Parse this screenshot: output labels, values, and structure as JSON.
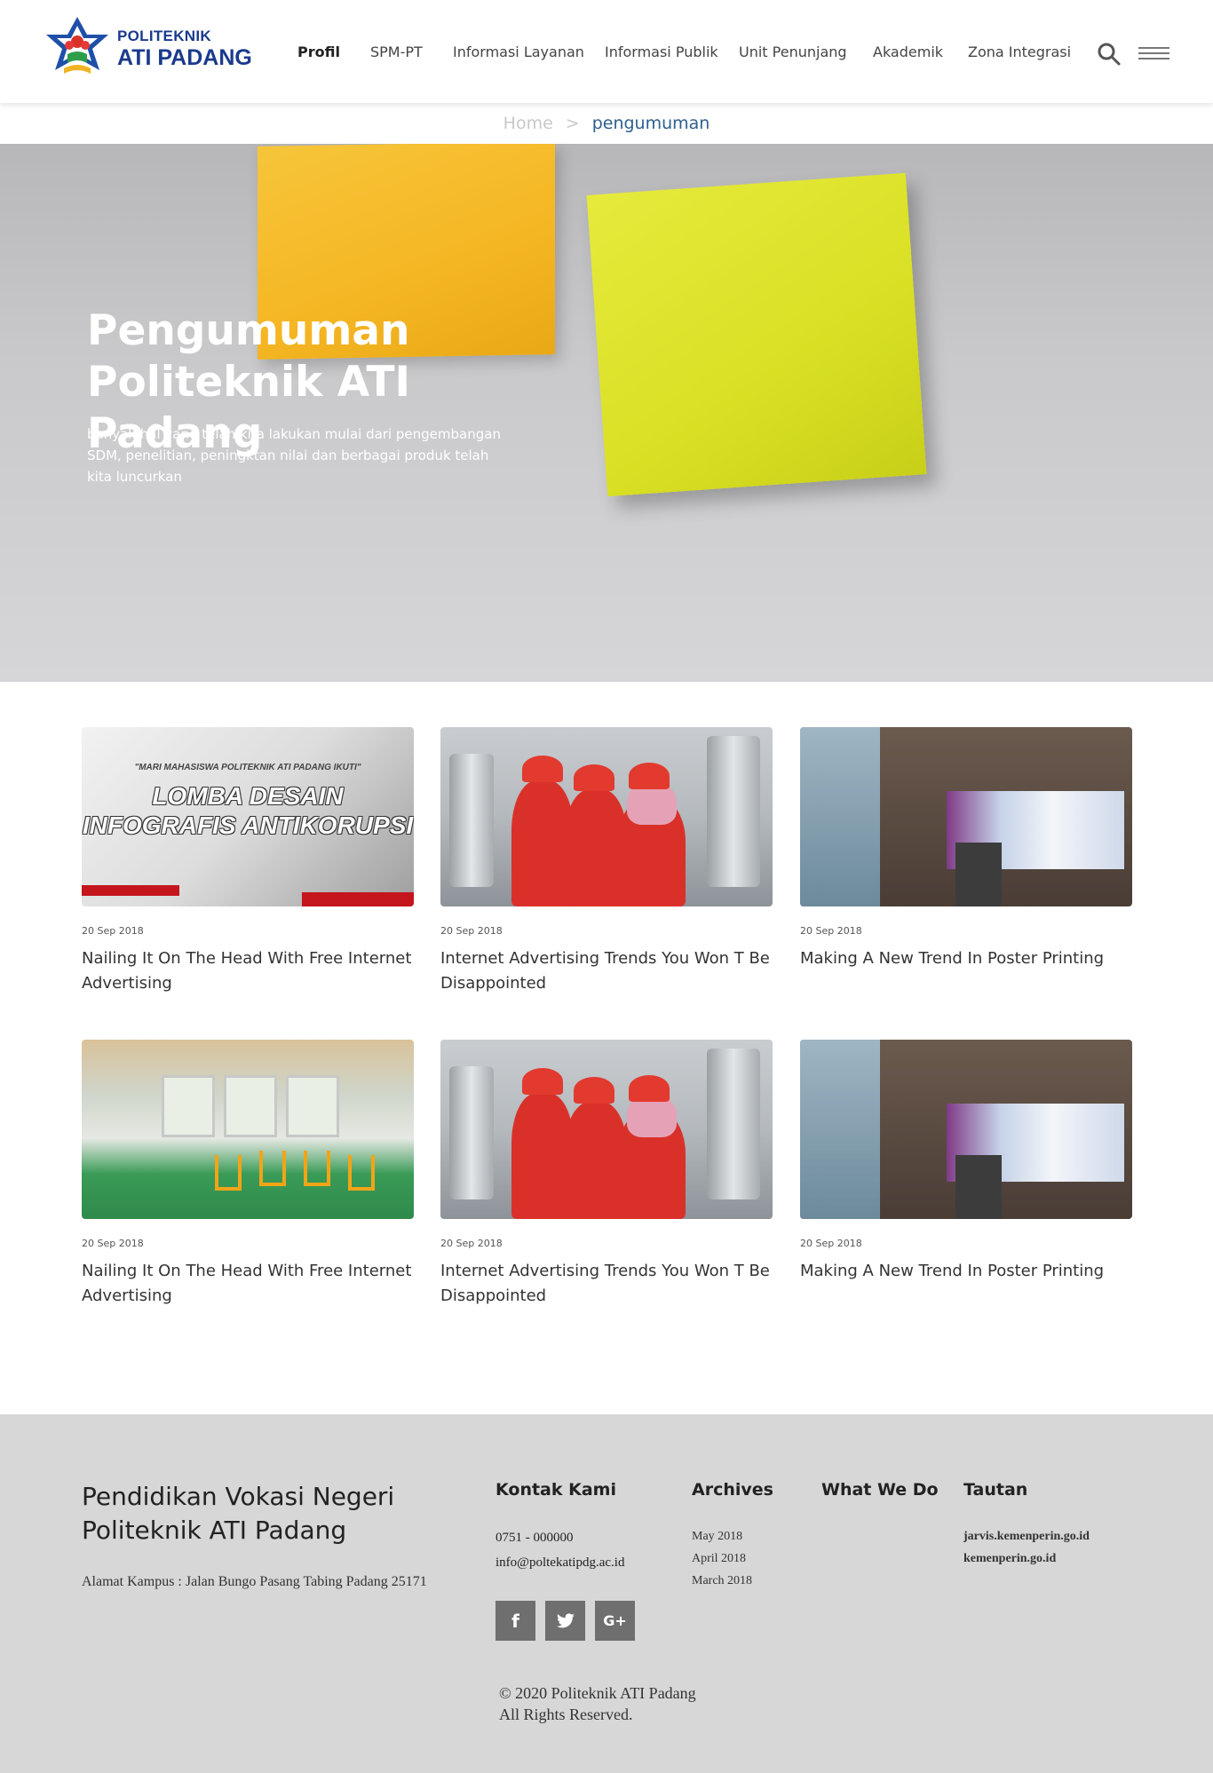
{
  "header": {
    "logo_line1": "POLITEKNIK",
    "logo_line2": "ATI PADANG",
    "nav": [
      "Profil",
      "SPM-PT",
      "Informasi Layanan",
      "Informasi Publik",
      "Unit Penunjang",
      "Akademik",
      "Zona Integrasi"
    ],
    "active_nav": "Profil",
    "search_icon": "search-icon",
    "menu_icon": "hamburger-menu-icon"
  },
  "breadcrumb": {
    "home": "Home",
    "separator": ">",
    "current": "pengumuman"
  },
  "hero": {
    "title_line1": "Pengumuman",
    "title_line2": "Politeknik ATI Padang",
    "description": "banyak hal yang telah kita lakukan mulai dari pengembangan SDM, penelitian, peningktan nilai dan berbagai produk telah kita luncurkan"
  },
  "posts": [
    {
      "date": "20 Sep 2018",
      "title": "Nailing It On The Head With Free Internet Advertising",
      "image": "poster"
    },
    {
      "date": "20 Sep 2018",
      "title": "Internet Advertising Trends You Won T Be Disappointed",
      "image": "workers"
    },
    {
      "date": "20 Sep 2018",
      "title": "Making A New Trend In Poster Printing",
      "image": "lecture"
    },
    {
      "date": "20 Sep 2018",
      "title": "Nailing It On The Head With Free Internet Advertising",
      "image": "workshop"
    },
    {
      "date": "20 Sep 2018",
      "title": "Internet Advertising Trends You Won T Be Disappointed",
      "image": "workers"
    },
    {
      "date": "20 Sep 2018",
      "title": "Making A New Trend In Poster Printing",
      "image": "lecture"
    }
  ],
  "poster_text": {
    "line1": "\"MARI MAHASISWA POLITEKNIK ATI PADANG IKUTI\"",
    "line2": "LOMBA DESAIN",
    "line3": "INFOGRAFIS ANTIKORUPSI"
  },
  "footer": {
    "tagline_line1": "Pendidikan Vokasi Negeri",
    "tagline_line2": "Politeknik ATI Padang",
    "address": "Alamat Kampus : Jalan Bungo Pasang Tabing Padang 25171",
    "contact_heading": "Kontak Kami",
    "phone": "0751 - 000000",
    "email": "info@poltekatipdg.ac.id",
    "archives_heading": "Archives",
    "archives": [
      "May 2018",
      "April 2018",
      "March 2018"
    ],
    "whatwedo_heading": "What We Do",
    "tautan_heading": "Tautan",
    "tautan": [
      "jarvis.kemenperin.go.id",
      "kemenperin.go.id"
    ],
    "socials": [
      "f",
      "t",
      "G+"
    ],
    "copyright_line1": "© 2020 Politeknik ATI Padang",
    "copyright_line2": "All Rights Reserved."
  },
  "colors": {
    "brand_blue": "#1a3a8c",
    "breadcrumb_current": "#2c5f8f",
    "footer_bg": "#d7d7d7",
    "social_bg": "#6f6f6f"
  }
}
